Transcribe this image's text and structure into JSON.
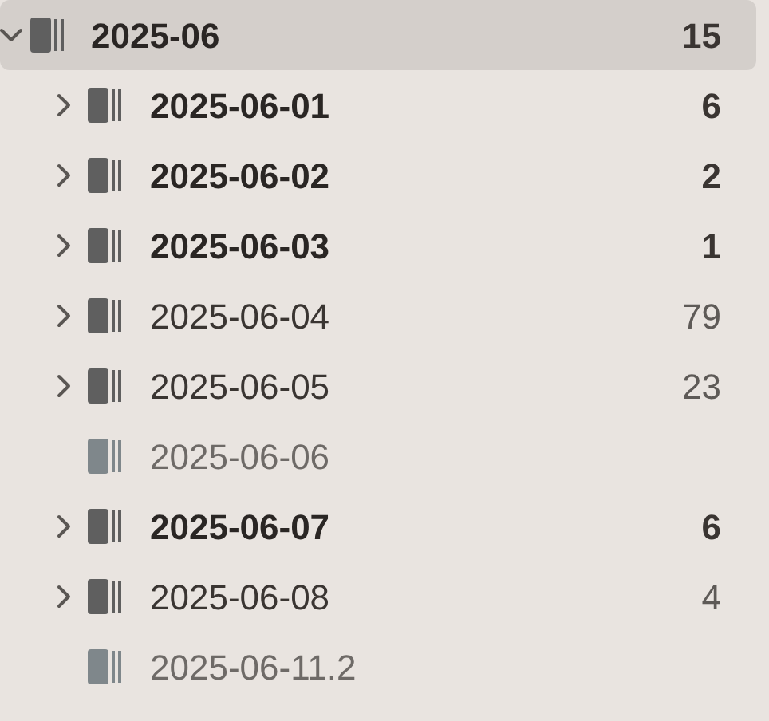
{
  "root": {
    "name": "2025-06",
    "count": "15",
    "bold": true,
    "selected": true,
    "expanded": true,
    "children": [
      {
        "name": "2025-06-01",
        "count": "6",
        "bold": true,
        "expandable": true,
        "dimmed": false
      },
      {
        "name": "2025-06-02",
        "count": "2",
        "bold": true,
        "expandable": true,
        "dimmed": false
      },
      {
        "name": "2025-06-03",
        "count": "1",
        "bold": true,
        "expandable": true,
        "dimmed": false
      },
      {
        "name": "2025-06-04",
        "count": "79",
        "bold": false,
        "expandable": true,
        "dimmed": false
      },
      {
        "name": "2025-06-05",
        "count": "23",
        "bold": false,
        "expandable": true,
        "dimmed": false
      },
      {
        "name": "2025-06-06",
        "bold": false,
        "expandable": false,
        "dimmed": true
      },
      {
        "name": "2025-06-07",
        "count": "6",
        "bold": true,
        "expandable": true,
        "dimmed": false
      },
      {
        "name": "2025-06-08",
        "count": "4",
        "bold": false,
        "expandable": true,
        "dimmed": false
      },
      {
        "name": "2025-06-11.2",
        "bold": false,
        "expandable": false,
        "dimmed": true
      }
    ]
  }
}
